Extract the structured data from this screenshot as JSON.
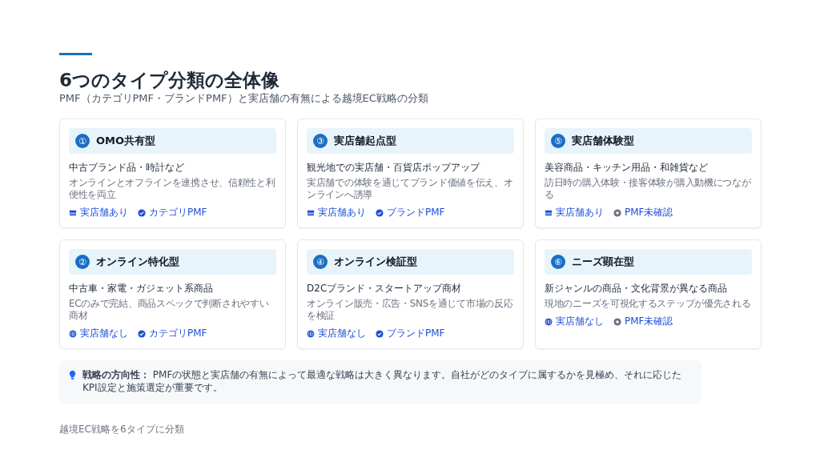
{
  "header": {
    "title": "6つのタイプ分類の全体像",
    "subtitle": "PMF（カテゴリPMF・ブランドPMF）と実店舗の有無による越境EC戦略の分類"
  },
  "cards": [
    {
      "number": "①",
      "name": "OMO共有型",
      "example": "中古ブランド品・時計など",
      "description": "オンラインとオフラインを連携させ、信頼性と利便性を両立",
      "tags": [
        {
          "kind": "store",
          "label": "実店舗あり"
        },
        {
          "kind": "confirmed",
          "label": "カテゴリPMF"
        }
      ]
    },
    {
      "number": "③",
      "name": "実店舗起点型",
      "example": "観光地での実店舗・百貨店ポップアップ",
      "description": "実店舗での体験を通じてブランド価値を伝え、オンラインへ誘導",
      "tags": [
        {
          "kind": "store",
          "label": "実店舗あり"
        },
        {
          "kind": "confirmed",
          "label": "ブランドPMF"
        }
      ]
    },
    {
      "number": "⑤",
      "name": "実店舗体験型",
      "example": "美容商品・キッチン用品・和雑貨など",
      "description": "訪日時の購入体験・接客体験が購入動機につながる",
      "tags": [
        {
          "kind": "store",
          "label": "実店舗あり"
        },
        {
          "kind": "unconfirmed",
          "label": "PMF未確認"
        }
      ]
    },
    {
      "number": "②",
      "name": "オンライン特化型",
      "example": "中古車・家電・ガジェット系商品",
      "description": "ECのみで完結、商品スペックで判断されやすい商材",
      "tags": [
        {
          "kind": "online",
          "label": "実店舗なし"
        },
        {
          "kind": "confirmed",
          "label": "カテゴリPMF"
        }
      ]
    },
    {
      "number": "④",
      "name": "オンライン検証型",
      "example": "D2Cブランド・スタートアップ商材",
      "description": "オンライン販売・広告・SNSを通じて市場の反応を検証",
      "tags": [
        {
          "kind": "online",
          "label": "実店舗なし"
        },
        {
          "kind": "confirmed",
          "label": "ブランドPMF"
        }
      ]
    },
    {
      "number": "⑥",
      "name": "ニーズ顕在型",
      "example": "新ジャンルの商品・文化背景が異なる商品",
      "description": "現地のニーズを可視化するステップが優先される",
      "tags": [
        {
          "kind": "online",
          "label": "実店舗なし"
        },
        {
          "kind": "unconfirmed",
          "label": "PMF未確認"
        }
      ]
    }
  ],
  "note": {
    "text": "**戦略の方向性：** PMFの状態と実店舗の有無によって最適な戦略は大きく異なります。自社がどのタイプに属するかを見極め、それに応じたKPI設定と施策選定が重要です。"
  },
  "footer": "越境EC戦略を6タイプに分類"
}
